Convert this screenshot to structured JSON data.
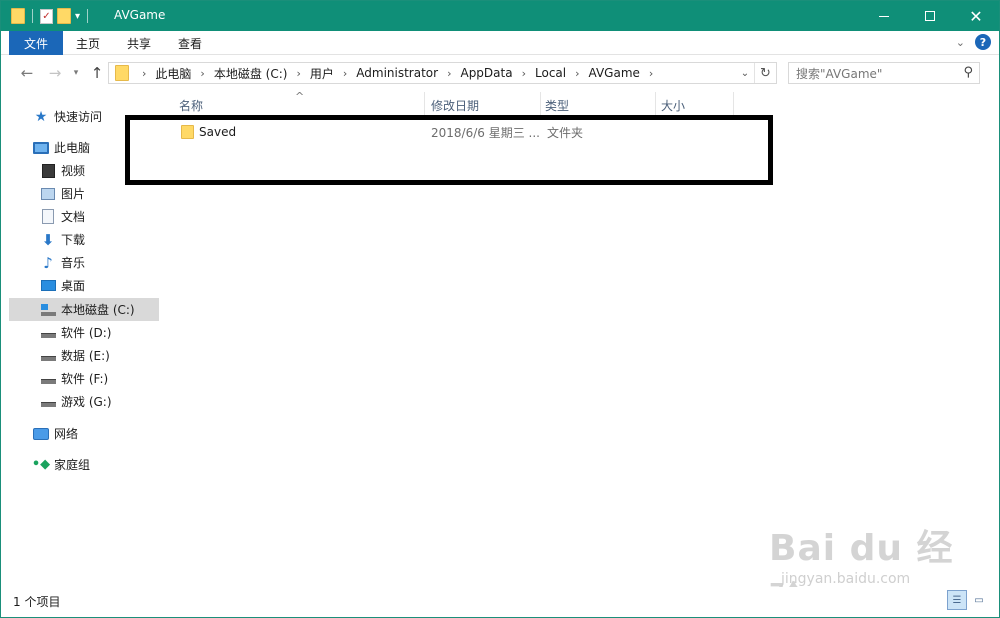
{
  "window": {
    "title": "AVGame",
    "controls": {
      "minimize": "minimize",
      "maximize": "maximize",
      "close": "✕"
    }
  },
  "ribbon": {
    "tabs": [
      "文件",
      "主页",
      "共享",
      "查看"
    ],
    "help": "?"
  },
  "address": {
    "crumbs": [
      "此电脑",
      "本地磁盘 (C:)",
      "用户",
      "Administrator",
      "AppData",
      "Local",
      "AVGame"
    ]
  },
  "search": {
    "placeholder": "搜索\"AVGame\""
  },
  "sidebar": {
    "items": [
      {
        "label": "快速访问",
        "icon": "star-icon"
      },
      {
        "label": "此电脑",
        "icon": "pc-icon"
      },
      {
        "label": "视频",
        "icon": "video-icon"
      },
      {
        "label": "图片",
        "icon": "picture-icon"
      },
      {
        "label": "文档",
        "icon": "document-icon"
      },
      {
        "label": "下载",
        "icon": "download-icon"
      },
      {
        "label": "音乐",
        "icon": "music-icon"
      },
      {
        "label": "桌面",
        "icon": "desktop-icon"
      },
      {
        "label": "本地磁盘 (C:)",
        "icon": "drive-c-icon",
        "selected": true
      },
      {
        "label": "软件 (D:)",
        "icon": "drive-icon"
      },
      {
        "label": "数据 (E:)",
        "icon": "drive-icon"
      },
      {
        "label": "软件 (F:)",
        "icon": "drive-icon"
      },
      {
        "label": "游戏 (G:)",
        "icon": "drive-icon"
      },
      {
        "label": "网络",
        "icon": "network-icon"
      },
      {
        "label": "家庭组",
        "icon": "homegroup-icon"
      }
    ]
  },
  "columns": {
    "name": "名称",
    "date": "修改日期",
    "type": "类型",
    "size": "大小"
  },
  "files": [
    {
      "name": "Saved",
      "date": "2018/6/6 星期三 ...",
      "type": "文件夹",
      "size": ""
    }
  ],
  "status": {
    "count": "1 个项目"
  },
  "watermark": {
    "logo": "Bai du 经验",
    "url": "jingyan.baidu.com"
  },
  "colors": {
    "titlebar": "#0f8f78",
    "file_tab": "#1b67b8",
    "selected": "#d9d9d9"
  }
}
